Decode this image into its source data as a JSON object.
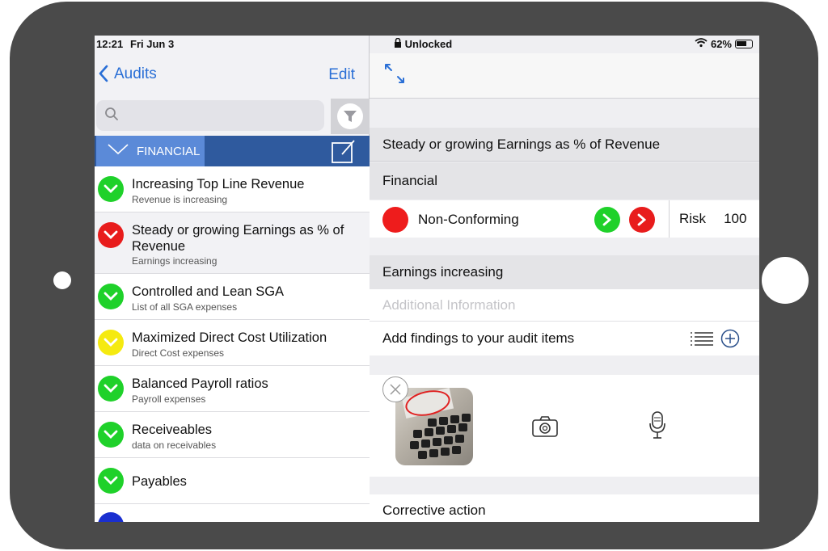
{
  "status": {
    "time": "12:21",
    "date": "Fri Jun 3",
    "lock_label": "Unlocked",
    "battery": "62%"
  },
  "left_nav": {
    "back_label": "Audits",
    "edit_label": "Edit"
  },
  "search": {
    "placeholder": ""
  },
  "section": {
    "label": "FINANCIAL",
    "color": "#2f5a9e",
    "tab_color": "#5b8ad8"
  },
  "list": {
    "items": [
      {
        "title": "Increasing Top Line Revenue",
        "subtitle": "Revenue is increasing",
        "status": "green"
      },
      {
        "title": "Steady or growing Earnings as % of Revenue",
        "subtitle": "Earnings increasing",
        "status": "red"
      },
      {
        "title": "Controlled and Lean SGA",
        "subtitle": "List of all SGA expenses",
        "status": "green"
      },
      {
        "title": "Maximized Direct Cost Utilization",
        "subtitle": "Direct Cost expenses",
        "status": "yellow"
      },
      {
        "title": "Balanced Payroll ratios",
        "subtitle": "Payroll expenses",
        "status": "green"
      },
      {
        "title": "Receiveables",
        "subtitle": "data on receivables",
        "status": "green"
      },
      {
        "title": "Payables",
        "subtitle": "",
        "status": "green"
      },
      {
        "title": "",
        "subtitle": "",
        "status": "blue"
      }
    ]
  },
  "colors": {
    "green": "#1fd12a",
    "red": "#e81c1c",
    "yellow": "#f5ea10",
    "blue": "#1a2fd0",
    "accent": "#2a6fd6"
  },
  "detail": {
    "item_title": "Steady or growing Earnings as % of Revenue",
    "category": "Financial",
    "status_label": "Non-Conforming",
    "risk_label": "Risk",
    "risk_value": "100",
    "description": "Earnings increasing",
    "additional_placeholder": "Additional Information",
    "findings_label": "Add findings to your audit items",
    "corrective_label": "Corrective action"
  },
  "icons": {
    "back": "chevron-left-icon",
    "filter": "filter-icon",
    "compose": "compose-icon",
    "expand": "expand-icon",
    "list": "list-icon",
    "add": "plus-circle-icon",
    "camera": "camera-icon",
    "mic": "microphone-icon",
    "remove": "close-icon"
  }
}
